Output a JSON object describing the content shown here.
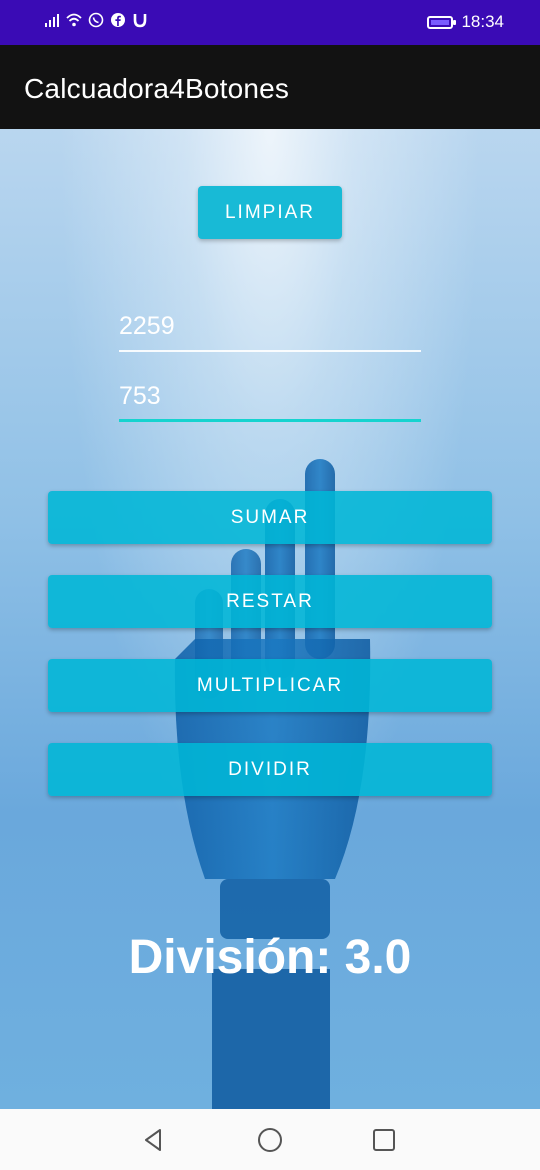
{
  "status_bar": {
    "time": "18:34",
    "icons": [
      "signal-icon",
      "wifi-icon",
      "whatsapp-icon",
      "facebook-icon",
      "magnet-icon",
      "battery-icon"
    ]
  },
  "app_bar": {
    "title": "Calcuadora4Botones"
  },
  "buttons": {
    "clear": "LIMPIAR",
    "add": "SUMAR",
    "subtract": "RESTAR",
    "multiply": "MULTIPLICAR",
    "divide": "DIVIDIR"
  },
  "inputs": {
    "first": "2259",
    "second": "753"
  },
  "result": "División: 3.0",
  "colors": {
    "status_bar": "#3a0bb5",
    "app_bar": "#121212",
    "button": "#12b6d6",
    "input_focus": "#16d3cf"
  }
}
